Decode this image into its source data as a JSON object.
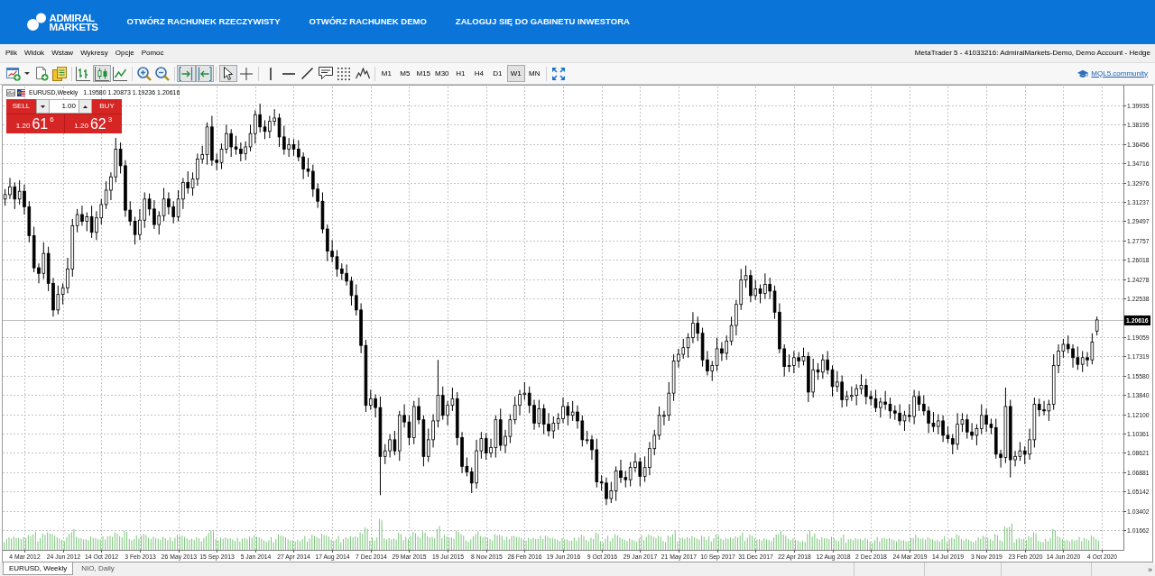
{
  "header": {
    "logo": "ADMIRAL MARKETS",
    "nav": [
      "OTWÓRZ RACHUNEK RZECZYWISTY",
      "OTWÓRZ RACHUNEK DEMO",
      "ZALOGUJ SIĘ DO GABINETU INWESTORA"
    ]
  },
  "menu_bar": {
    "items": [
      "Plik",
      "Widok",
      "Wstaw",
      "Wykresy",
      "Opcje",
      "Pomoc"
    ],
    "title": "MetaTrader 5 - 41033216: AdmiralMarkets-Demo, Demo Account - Hedge"
  },
  "toolbar": {
    "items": [
      {
        "kind": "new-chart",
        "pressed": false
      },
      {
        "kind": "dropdown",
        "pressed": false
      },
      {
        "kind": "new-document",
        "pressed": false
      },
      {
        "kind": "profiles",
        "pressed": false
      },
      {
        "kind": "separator"
      },
      {
        "kind": "bar-chart",
        "pressed": false
      },
      {
        "kind": "candlesticks",
        "pressed": true
      },
      {
        "kind": "line-chart",
        "pressed": false
      },
      {
        "kind": "separator"
      },
      {
        "kind": "zoom-in",
        "pressed": false
      },
      {
        "kind": "zoom-out",
        "pressed": false
      },
      {
        "kind": "separator"
      },
      {
        "kind": "chart-shift",
        "pressed": true
      },
      {
        "kind": "autoscroll",
        "pressed": true
      },
      {
        "kind": "separator"
      },
      {
        "kind": "cursor",
        "pressed": true
      },
      {
        "kind": "crosshair",
        "pressed": false
      },
      {
        "kind": "separator"
      },
      {
        "kind": "vertical-line",
        "pressed": false
      },
      {
        "kind": "horizontal-line",
        "pressed": false
      },
      {
        "kind": "trend-line",
        "pressed": false
      },
      {
        "kind": "text-label",
        "pressed": false
      },
      {
        "kind": "fibonacci",
        "pressed": false
      },
      {
        "kind": "elliott-wave",
        "pressed": false
      },
      {
        "kind": "separator"
      },
      {
        "kind": "timeframe",
        "label": "M1",
        "selected": false
      },
      {
        "kind": "timeframe",
        "label": "M5",
        "selected": false
      },
      {
        "kind": "timeframe",
        "label": "M15",
        "selected": false
      },
      {
        "kind": "timeframe",
        "label": "M30",
        "selected": false
      },
      {
        "kind": "timeframe",
        "label": "H1",
        "selected": false
      },
      {
        "kind": "timeframe",
        "label": "H4",
        "selected": false
      },
      {
        "kind": "timeframe",
        "label": "D1",
        "selected": false
      },
      {
        "kind": "timeframe",
        "label": "W1",
        "selected": true
      },
      {
        "kind": "timeframe",
        "label": "MN",
        "selected": false
      },
      {
        "kind": "separator"
      },
      {
        "kind": "fullscreen",
        "pressed": false
      }
    ],
    "community_link": "MQL5.community"
  },
  "chart": {
    "symbol": "EURUSD,Weekly",
    "ohlc": "1.19580 1.20873 1.19236 1.20616",
    "trade_panel": {
      "sell": "SELL",
      "buy": "BUY",
      "volume": "1.00",
      "sell_price": {
        "prefix": "1.20",
        "pips": "61",
        "fraction": "6"
      },
      "buy_price": {
        "prefix": "1.20",
        "pips": "62",
        "fraction": "3"
      }
    },
    "chart_data": {
      "type": "candlestick",
      "grid": true,
      "categories": [
        null,
        null,
        null,
        null,
        "4 Mar 2012",
        null,
        null,
        null,
        null,
        null,
        null,
        null,
        "24 Jun 2012",
        null,
        null,
        null,
        null,
        null,
        null,
        null,
        "14 Oct 2012",
        null,
        null,
        null,
        null,
        null,
        null,
        null,
        "3 Feb 2013",
        null,
        null,
        null,
        null,
        null,
        null,
        null,
        "26 May 2013",
        null,
        null,
        null,
        null,
        null,
        null,
        null,
        "15 Sep 2013",
        null,
        null,
        null,
        null,
        null,
        null,
        null,
        "5 Jan 2014",
        null,
        null,
        null,
        null,
        null,
        null,
        null,
        "27 Apr 2014",
        null,
        null,
        null,
        null,
        null,
        null,
        null,
        "17 Aug 2014",
        null,
        null,
        null,
        null,
        null,
        null,
        null,
        "7 Dec 2014",
        null,
        null,
        null,
        null,
        null,
        null,
        null,
        "29 Mar 2015",
        null,
        null,
        null,
        null,
        null,
        null,
        null,
        "19 Jul 2015",
        null,
        null,
        null,
        null,
        null,
        null,
        null,
        "8 Nov 2015",
        null,
        null,
        null,
        null,
        null,
        null,
        null,
        "28 Feb 2016",
        null,
        null,
        null,
        null,
        null,
        null,
        null,
        "19 Jun 2016",
        null,
        null,
        null,
        null,
        null,
        null,
        null,
        "9 Oct 2016",
        null,
        null,
        null,
        null,
        null,
        null,
        null,
        "29 Jan 2017",
        null,
        null,
        null,
        null,
        null,
        null,
        null,
        "21 May 2017",
        null,
        null,
        null,
        null,
        null,
        null,
        null,
        "10 Sep 2017",
        null,
        null,
        null,
        null,
        null,
        null,
        null,
        "31 Dec 2017",
        null,
        null,
        null,
        null,
        null,
        null,
        null,
        "22 Apr 2018",
        null,
        null,
        null,
        null,
        null,
        null,
        null,
        "12 Aug 2018",
        null,
        null,
        null,
        null,
        null,
        null,
        null,
        "2 Dec 2018",
        null,
        null,
        null,
        null,
        null,
        null,
        null,
        "24 Mar 2019",
        null,
        null,
        null,
        null,
        null,
        null,
        null,
        "14 Jul 2019",
        null,
        null,
        null,
        null,
        null,
        null,
        null,
        "3 Nov 2019",
        null,
        null,
        null,
        null,
        null,
        null,
        null,
        "23 Feb 2020",
        null,
        null,
        null,
        null,
        null,
        null,
        null,
        "14 Jun 2020",
        null,
        null,
        null,
        null,
        null,
        null,
        null,
        "4 Oct 2020",
        null,
        null,
        null,
        null
      ],
      "ohlc": [
        [
          1.315,
          1.324,
          1.309,
          1.319
        ],
        [
          1.319,
          1.334,
          1.315,
          1.326
        ],
        [
          1.326,
          1.33,
          1.306,
          1.315
        ],
        [
          1.315,
          1.332,
          1.31,
          1.322
        ],
        [
          1.322,
          1.328,
          1.301,
          1.308
        ],
        [
          1.308,
          1.313,
          1.276,
          1.282
        ],
        [
          1.282,
          1.29,
          1.249,
          1.253
        ],
        [
          1.253,
          1.257,
          1.239,
          1.248
        ],
        [
          1.248,
          1.276,
          1.243,
          1.266
        ],
        [
          1.266,
          1.272,
          1.232,
          1.239
        ],
        [
          1.239,
          1.244,
          1.209,
          1.215
        ],
        [
          1.215,
          1.237,
          1.211,
          1.229
        ],
        [
          1.229,
          1.239,
          1.22,
          1.235
        ],
        [
          1.235,
          1.262,
          1.23,
          1.252
        ],
        [
          1.252,
          1.297,
          1.245,
          1.291
        ],
        [
          1.291,
          1.306,
          1.285,
          1.301
        ],
        [
          1.301,
          1.309,
          1.291,
          1.295
        ],
        [
          1.295,
          1.303,
          1.286,
          1.299
        ],
        [
          1.299,
          1.309,
          1.28,
          1.285
        ],
        [
          1.285,
          1.304,
          1.278,
          1.298
        ],
        [
          1.298,
          1.315,
          1.292,
          1.31
        ],
        [
          1.31,
          1.331,
          1.306,
          1.323
        ],
        [
          1.323,
          1.339,
          1.314,
          1.335
        ],
        [
          1.335,
          1.37,
          1.33,
          1.36
        ],
        [
          1.36,
          1.366,
          1.338,
          1.345
        ],
        [
          1.345,
          1.35,
          1.299,
          1.305
        ],
        [
          1.305,
          1.313,
          1.291,
          1.295
        ],
        [
          1.295,
          1.299,
          1.274,
          1.283
        ],
        [
          1.283,
          1.306,
          1.278,
          1.296
        ],
        [
          1.296,
          1.321,
          1.289,
          1.315
        ],
        [
          1.315,
          1.32,
          1.3,
          1.306
        ],
        [
          1.306,
          1.314,
          1.288,
          1.292
        ],
        [
          1.292,
          1.304,
          1.283,
          1.3
        ],
        [
          1.3,
          1.325,
          1.295,
          1.315
        ],
        [
          1.315,
          1.321,
          1.301,
          1.308
        ],
        [
          1.308,
          1.313,
          1.293,
          1.299
        ],
        [
          1.299,
          1.323,
          1.295,
          1.315
        ],
        [
          1.315,
          1.334,
          1.306,
          1.33
        ],
        [
          1.33,
          1.34,
          1.32,
          1.325
        ],
        [
          1.325,
          1.339,
          1.318,
          1.333
        ],
        [
          1.333,
          1.356,
          1.327,
          1.351
        ],
        [
          1.351,
          1.363,
          1.347,
          1.355
        ],
        [
          1.355,
          1.384,
          1.346,
          1.38
        ],
        [
          1.38,
          1.39,
          1.345,
          1.35
        ],
        [
          1.35,
          1.356,
          1.341,
          1.348
        ],
        [
          1.348,
          1.365,
          1.342,
          1.36
        ],
        [
          1.36,
          1.382,
          1.356,
          1.374
        ],
        [
          1.374,
          1.378,
          1.353,
          1.362
        ],
        [
          1.362,
          1.372,
          1.355,
          1.36
        ],
        [
          1.36,
          1.366,
          1.349,
          1.356
        ],
        [
          1.356,
          1.367,
          1.35,
          1.362
        ],
        [
          1.362,
          1.382,
          1.358,
          1.374
        ],
        [
          1.374,
          1.395,
          1.365,
          1.391
        ],
        [
          1.391,
          1.401,
          1.375,
          1.38
        ],
        [
          1.38,
          1.386,
          1.369,
          1.376
        ],
        [
          1.376,
          1.39,
          1.37,
          1.385
        ],
        [
          1.385,
          1.396,
          1.381,
          1.388
        ],
        [
          1.388,
          1.392,
          1.362,
          1.371
        ],
        [
          1.371,
          1.381,
          1.355,
          1.36
        ],
        [
          1.36,
          1.37,
          1.353,
          1.364
        ],
        [
          1.364,
          1.369,
          1.354,
          1.36
        ],
        [
          1.36,
          1.368,
          1.349,
          1.353
        ],
        [
          1.353,
          1.357,
          1.333,
          1.342
        ],
        [
          1.342,
          1.352,
          1.335,
          1.34
        ],
        [
          1.34,
          1.346,
          1.317,
          1.324
        ],
        [
          1.324,
          1.329,
          1.307,
          1.313
        ],
        [
          1.313,
          1.321,
          1.284,
          1.288
        ],
        [
          1.288,
          1.292,
          1.259,
          1.268
        ],
        [
          1.268,
          1.278,
          1.258,
          1.263
        ],
        [
          1.263,
          1.269,
          1.245,
          1.252
        ],
        [
          1.252,
          1.257,
          1.242,
          1.248
        ],
        [
          1.248,
          1.256,
          1.237,
          1.241
        ],
        [
          1.241,
          1.245,
          1.219,
          1.228
        ],
        [
          1.228,
          1.238,
          1.21,
          1.215
        ],
        [
          1.215,
          1.221,
          1.176,
          1.183
        ],
        [
          1.183,
          1.188,
          1.123,
          1.129
        ],
        [
          1.129,
          1.143,
          1.125,
          1.135
        ],
        [
          1.135,
          1.139,
          1.118,
          1.127
        ],
        [
          1.127,
          1.137,
          1.048,
          1.083
        ],
        [
          1.083,
          1.094,
          1.076,
          1.088
        ],
        [
          1.088,
          1.103,
          1.082,
          1.098
        ],
        [
          1.098,
          1.106,
          1.084,
          1.088
        ],
        [
          1.088,
          1.124,
          1.079,
          1.12
        ],
        [
          1.12,
          1.13,
          1.109,
          1.114
        ],
        [
          1.114,
          1.12,
          1.093,
          1.1
        ],
        [
          1.1,
          1.133,
          1.094,
          1.128
        ],
        [
          1.128,
          1.136,
          1.112,
          1.116
        ],
        [
          1.116,
          1.12,
          1.074,
          1.083
        ],
        [
          1.083,
          1.108,
          1.078,
          1.098
        ],
        [
          1.098,
          1.121,
          1.091,
          1.115
        ],
        [
          1.115,
          1.17,
          1.109,
          1.138
        ],
        [
          1.138,
          1.146,
          1.116,
          1.12
        ],
        [
          1.12,
          1.133,
          1.111,
          1.129
        ],
        [
          1.129,
          1.145,
          1.124,
          1.135
        ],
        [
          1.135,
          1.141,
          1.093,
          1.1
        ],
        [
          1.1,
          1.105,
          1.068,
          1.074
        ],
        [
          1.074,
          1.082,
          1.065,
          1.069
        ],
        [
          1.069,
          1.073,
          1.05,
          1.059
        ],
        [
          1.059,
          1.098,
          1.054,
          1.088
        ],
        [
          1.088,
          1.105,
          1.081,
          1.099
        ],
        [
          1.099,
          1.104,
          1.08,
          1.086
        ],
        [
          1.086,
          1.099,
          1.082,
          1.091
        ],
        [
          1.091,
          1.12,
          1.082,
          1.116
        ],
        [
          1.116,
          1.126,
          1.088,
          1.093
        ],
        [
          1.093,
          1.107,
          1.086,
          1.101
        ],
        [
          1.101,
          1.121,
          1.095,
          1.116
        ],
        [
          1.116,
          1.137,
          1.112,
          1.129
        ],
        [
          1.129,
          1.143,
          1.12,
          1.139
        ],
        [
          1.139,
          1.15,
          1.134,
          1.14
        ],
        [
          1.14,
          1.146,
          1.122,
          1.129
        ],
        [
          1.129,
          1.134,
          1.107,
          1.113
        ],
        [
          1.113,
          1.134,
          1.109,
          1.126
        ],
        [
          1.126,
          1.13,
          1.103,
          1.112
        ],
        [
          1.112,
          1.122,
          1.101,
          1.106
        ],
        [
          1.106,
          1.119,
          1.099,
          1.113
        ],
        [
          1.113,
          1.122,
          1.107,
          1.117
        ],
        [
          1.117,
          1.136,
          1.113,
          1.128
        ],
        [
          1.128,
          1.132,
          1.111,
          1.12
        ],
        [
          1.12,
          1.133,
          1.115,
          1.123
        ],
        [
          1.123,
          1.129,
          1.108,
          1.115
        ],
        [
          1.115,
          1.12,
          1.092,
          1.098
        ],
        [
          1.098,
          1.106,
          1.094,
          1.098
        ],
        [
          1.098,
          1.102,
          1.08,
          1.089
        ],
        [
          1.089,
          1.099,
          1.055,
          1.06
        ],
        [
          1.06,
          1.066,
          1.052,
          1.059
        ],
        [
          1.059,
          1.064,
          1.039,
          1.045
        ],
        [
          1.045,
          1.06,
          1.041,
          1.052
        ],
        [
          1.052,
          1.074,
          1.043,
          1.07
        ],
        [
          1.07,
          1.08,
          1.059,
          1.064
        ],
        [
          1.064,
          1.07,
          1.055,
          1.062
        ],
        [
          1.062,
          1.078,
          1.056,
          1.073
        ],
        [
          1.073,
          1.086,
          1.069,
          1.078
        ],
        [
          1.078,
          1.082,
          1.056,
          1.065
        ],
        [
          1.065,
          1.083,
          1.06,
          1.073
        ],
        [
          1.073,
          1.096,
          1.066,
          1.09
        ],
        [
          1.09,
          1.107,
          1.084,
          1.102
        ],
        [
          1.102,
          1.128,
          1.098,
          1.12
        ],
        [
          1.12,
          1.124,
          1.111,
          1.12
        ],
        [
          1.12,
          1.15,
          1.115,
          1.14
        ],
        [
          1.14,
          1.175,
          1.133,
          1.169
        ],
        [
          1.169,
          1.18,
          1.163,
          1.175
        ],
        [
          1.175,
          1.189,
          1.171,
          1.181
        ],
        [
          1.181,
          1.194,
          1.172,
          1.19
        ],
        [
          1.19,
          1.213,
          1.185,
          1.203
        ],
        [
          1.203,
          1.209,
          1.187,
          1.194
        ],
        [
          1.194,
          1.199,
          1.164,
          1.17
        ],
        [
          1.17,
          1.178,
          1.156,
          1.16
        ],
        [
          1.16,
          1.169,
          1.151,
          1.165
        ],
        [
          1.165,
          1.19,
          1.16,
          1.18
        ],
        [
          1.18,
          1.186,
          1.169,
          1.176
        ],
        [
          1.176,
          1.192,
          1.17,
          1.187
        ],
        [
          1.187,
          1.209,
          1.183,
          1.201
        ],
        [
          1.201,
          1.224,
          1.192,
          1.22
        ],
        [
          1.22,
          1.252,
          1.215,
          1.242
        ],
        [
          1.242,
          1.255,
          1.235,
          1.246
        ],
        [
          1.246,
          1.251,
          1.222,
          1.228
        ],
        [
          1.228,
          1.242,
          1.224,
          1.234
        ],
        [
          1.234,
          1.238,
          1.221,
          1.23
        ],
        [
          1.23,
          1.248,
          1.225,
          1.238
        ],
        [
          1.238,
          1.244,
          1.225,
          1.232
        ],
        [
          1.232,
          1.237,
          1.207,
          1.213
        ],
        [
          1.213,
          1.221,
          1.176,
          1.18
        ],
        [
          1.18,
          1.184,
          1.155,
          1.164
        ],
        [
          1.164,
          1.175,
          1.159,
          1.165
        ],
        [
          1.165,
          1.178,
          1.158,
          1.172
        ],
        [
          1.172,
          1.177,
          1.163,
          1.169
        ],
        [
          1.169,
          1.181,
          1.165,
          1.173
        ],
        [
          1.173,
          1.177,
          1.132,
          1.141
        ],
        [
          1.141,
          1.171,
          1.136,
          1.161
        ],
        [
          1.161,
          1.167,
          1.152,
          1.159
        ],
        [
          1.159,
          1.175,
          1.153,
          1.17
        ],
        [
          1.17,
          1.178,
          1.157,
          1.161
        ],
        [
          1.161,
          1.165,
          1.137,
          1.146
        ],
        [
          1.146,
          1.16,
          1.141,
          1.15
        ],
        [
          1.15,
          1.156,
          1.127,
          1.134
        ],
        [
          1.134,
          1.142,
          1.128,
          1.137
        ],
        [
          1.137,
          1.146,
          1.133,
          1.138
        ],
        [
          1.138,
          1.148,
          1.129,
          1.144
        ],
        [
          1.144,
          1.157,
          1.139,
          1.147
        ],
        [
          1.147,
          1.153,
          1.13,
          1.137
        ],
        [
          1.137,
          1.142,
          1.129,
          1.135
        ],
        [
          1.135,
          1.143,
          1.123,
          1.127
        ],
        [
          1.127,
          1.136,
          1.118,
          1.132
        ],
        [
          1.132,
          1.142,
          1.125,
          1.13
        ],
        [
          1.13,
          1.136,
          1.117,
          1.124
        ],
        [
          1.124,
          1.129,
          1.116,
          1.122
        ],
        [
          1.122,
          1.13,
          1.111,
          1.115
        ],
        [
          1.115,
          1.124,
          1.106,
          1.12
        ],
        [
          1.12,
          1.13,
          1.114,
          1.119
        ],
        [
          1.119,
          1.143,
          1.112,
          1.137
        ],
        [
          1.137,
          1.142,
          1.124,
          1.13
        ],
        [
          1.13,
          1.138,
          1.12,
          1.124
        ],
        [
          1.124,
          1.128,
          1.104,
          1.113
        ],
        [
          1.113,
          1.123,
          1.105,
          1.11
        ],
        [
          1.11,
          1.121,
          1.103,
          1.115
        ],
        [
          1.115,
          1.12,
          1.096,
          1.102
        ],
        [
          1.102,
          1.11,
          1.095,
          1.099
        ],
        [
          1.099,
          1.103,
          1.085,
          1.094
        ],
        [
          1.094,
          1.122,
          1.089,
          1.112
        ],
        [
          1.112,
          1.122,
          1.105,
          1.116
        ],
        [
          1.116,
          1.121,
          1.099,
          1.105
        ],
        [
          1.105,
          1.113,
          1.098,
          1.102
        ],
        [
          1.102,
          1.112,
          1.093,
          1.108
        ],
        [
          1.108,
          1.13,
          1.103,
          1.12
        ],
        [
          1.12,
          1.126,
          1.105,
          1.112
        ],
        [
          1.112,
          1.117,
          1.103,
          1.109
        ],
        [
          1.109,
          1.117,
          1.081,
          1.085
        ],
        [
          1.085,
          1.089,
          1.073,
          1.082
        ],
        [
          1.082,
          1.145,
          1.077,
          1.128
        ],
        [
          1.128,
          1.134,
          1.064,
          1.08
        ],
        [
          1.08,
          1.088,
          1.074,
          1.083
        ],
        [
          1.083,
          1.096,
          1.079,
          1.088
        ],
        [
          1.088,
          1.092,
          1.076,
          1.085
        ],
        [
          1.085,
          1.108,
          1.08,
          1.098
        ],
        [
          1.098,
          1.136,
          1.091,
          1.13
        ],
        [
          1.13,
          1.135,
          1.119,
          1.125
        ],
        [
          1.125,
          1.133,
          1.12,
          1.124
        ],
        [
          1.124,
          1.134,
          1.115,
          1.13
        ],
        [
          1.13,
          1.175,
          1.125,
          1.165
        ],
        [
          1.165,
          1.184,
          1.158,
          1.178
        ],
        [
          1.178,
          1.189,
          1.172,
          1.184
        ],
        [
          1.184,
          1.192,
          1.176,
          1.18
        ],
        [
          1.18,
          1.184,
          1.163,
          1.172
        ],
        [
          1.172,
          1.182,
          1.161,
          1.166
        ],
        [
          1.166,
          1.178,
          1.159,
          1.172
        ],
        [
          1.172,
          1.177,
          1.164,
          1.17
        ],
        [
          1.17,
          1.194,
          1.166,
          1.186
        ],
        [
          1.196,
          1.209,
          1.192,
          1.206
        ],
        null,
        null,
        null,
        null,
        null
      ],
      "ylim": [
        0.99874,
        1.41641
      ],
      "yticks": [
        1.39935,
        1.38195,
        1.36456,
        1.34716,
        1.32976,
        1.31237,
        1.29497,
        1.27757,
        1.26018,
        1.24278,
        1.22538,
        1.19059,
        1.17319,
        {
          "value": 1.1558,
          "label": "1.15580"
        },
        {
          "value": 1.1384,
          "label": "1.13840"
        },
        {
          "value": 1.121,
          "label": "1.12100"
        },
        1.10361,
        1.08621,
        1.06881,
        1.05142,
        1.03402,
        1.01662
      ],
      "ref_lines": [
        {
          "axis": "y",
          "value": 1.20616,
          "label": "1.20616"
        }
      ]
    }
  },
  "tabs": [
    {
      "label": "EURUSD, Weekly",
      "selected": true
    },
    {
      "label": "NIO, Daily",
      "selected": false
    }
  ],
  "tabs_overflow": "»"
}
